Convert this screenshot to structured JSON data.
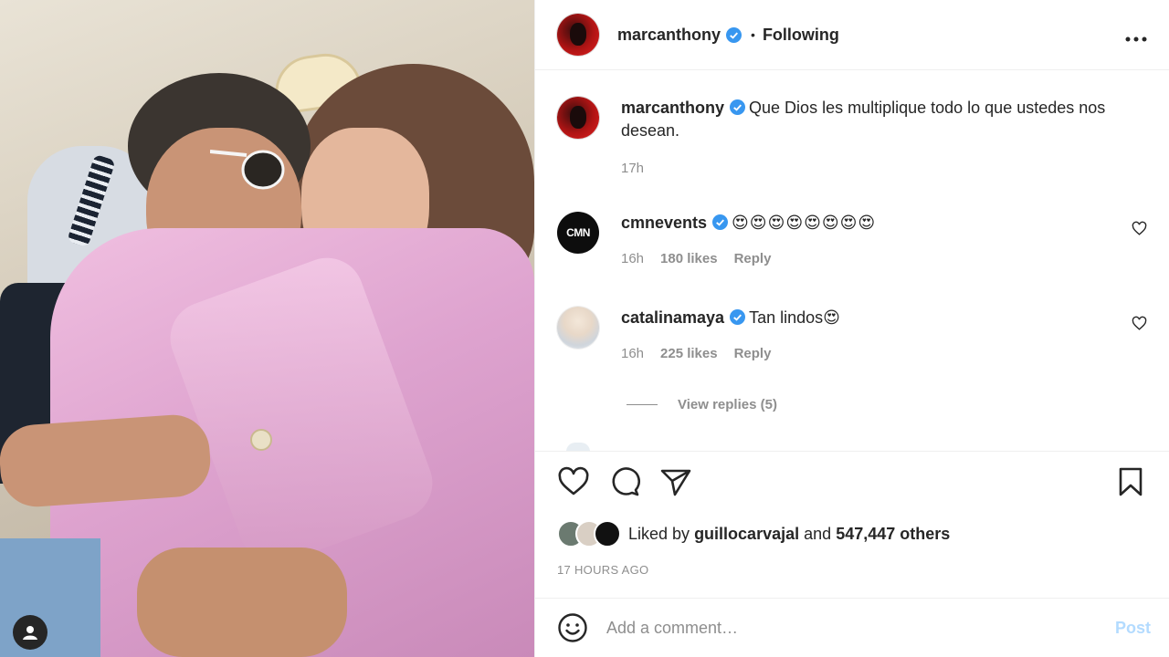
{
  "post_author": {
    "username": "marcanthony",
    "verified": true,
    "follow_status": "Following"
  },
  "caption": {
    "username": "marcanthony",
    "text": "Que Dios les multiplique todo lo que ustedes nos desean.",
    "time": "17h"
  },
  "comments": [
    {
      "username": "cmnevents",
      "avatar_text": "CMN",
      "text": "😍😍😍😍😍😍😍😍",
      "time": "16h",
      "likes": "180 likes",
      "reply": "Reply"
    },
    {
      "username": "catalinamaya",
      "text": "Tan lindos😍",
      "time": "16h",
      "likes": "225 likes",
      "reply": "Reply",
      "view_replies": "View replies (5)"
    }
  ],
  "likes": {
    "prefix": "Liked by",
    "user": "guillocarvajal",
    "and": "and",
    "others": "547,447 others"
  },
  "timestamp": "17 HOURS AGO",
  "add_comment": {
    "placeholder": "Add a comment…",
    "post_label": "Post"
  },
  "icons": {
    "more": "more-options-icon",
    "like": "heart-icon",
    "comment": "comment-icon",
    "share": "paper-plane-icon",
    "save": "bookmark-icon",
    "emoji": "smiley-icon",
    "profile": "user-icon"
  },
  "colors": {
    "verified": "#3897f0",
    "text": "#262626",
    "muted": "#8e8e8e",
    "post_disabled": "#b3dbff",
    "border": "#efefef"
  }
}
